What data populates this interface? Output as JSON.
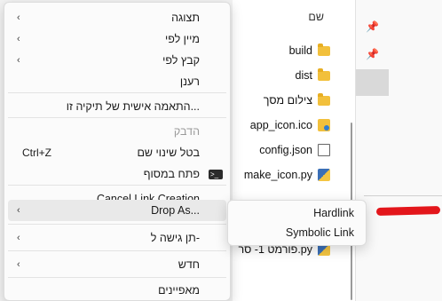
{
  "explorer": {
    "column_header": "שם",
    "files": [
      {
        "name": "build",
        "icon": "folder-icon"
      },
      {
        "name": "dist",
        "icon": "folder-icon"
      },
      {
        "name": "צילום מסך",
        "icon": "folder-icon"
      },
      {
        "name": "app_icon.ico",
        "icon": "ico-file-icon"
      },
      {
        "name": "config.json",
        "icon": "document-icon"
      },
      {
        "name": "make_icon.py",
        "icon": "python-file-icon"
      },
      {
        "name": "פורמט 1- סר.py",
        "icon": "python-file-icon"
      }
    ],
    "quick_access_icons": [
      "pin-icon",
      "pin-icon"
    ]
  },
  "context_menu": {
    "items": [
      {
        "label": "תצוגה",
        "submenu": true
      },
      {
        "label": "מיין לפי",
        "submenu": true
      },
      {
        "label": "קבץ לפי",
        "submenu": true
      },
      {
        "label": "רענן",
        "submenu": false
      },
      {
        "label": "התאמה אישית של תיקיה זו...",
        "submenu": false
      },
      {
        "label": "הדבק",
        "submenu": false,
        "disabled": true
      },
      {
        "label": "בטל שינוי שם",
        "shortcut": "Ctrl+Z",
        "submenu": false
      },
      {
        "label": "פתח במסוף",
        "submenu": false,
        "icon": "terminal-icon"
      },
      {
        "label": "Cancel Link Creation",
        "submenu": false
      },
      {
        "label": "Drop As...",
        "submenu": true
      },
      {
        "label": "תן גישה ל-",
        "submenu": true
      },
      {
        "label": "חדש",
        "submenu": true
      },
      {
        "label": "מאפיינים",
        "submenu": false
      }
    ]
  },
  "submenu": {
    "items": [
      "Hardlink",
      "Symbolic Link"
    ]
  },
  "annotation_color": "#e3161b"
}
